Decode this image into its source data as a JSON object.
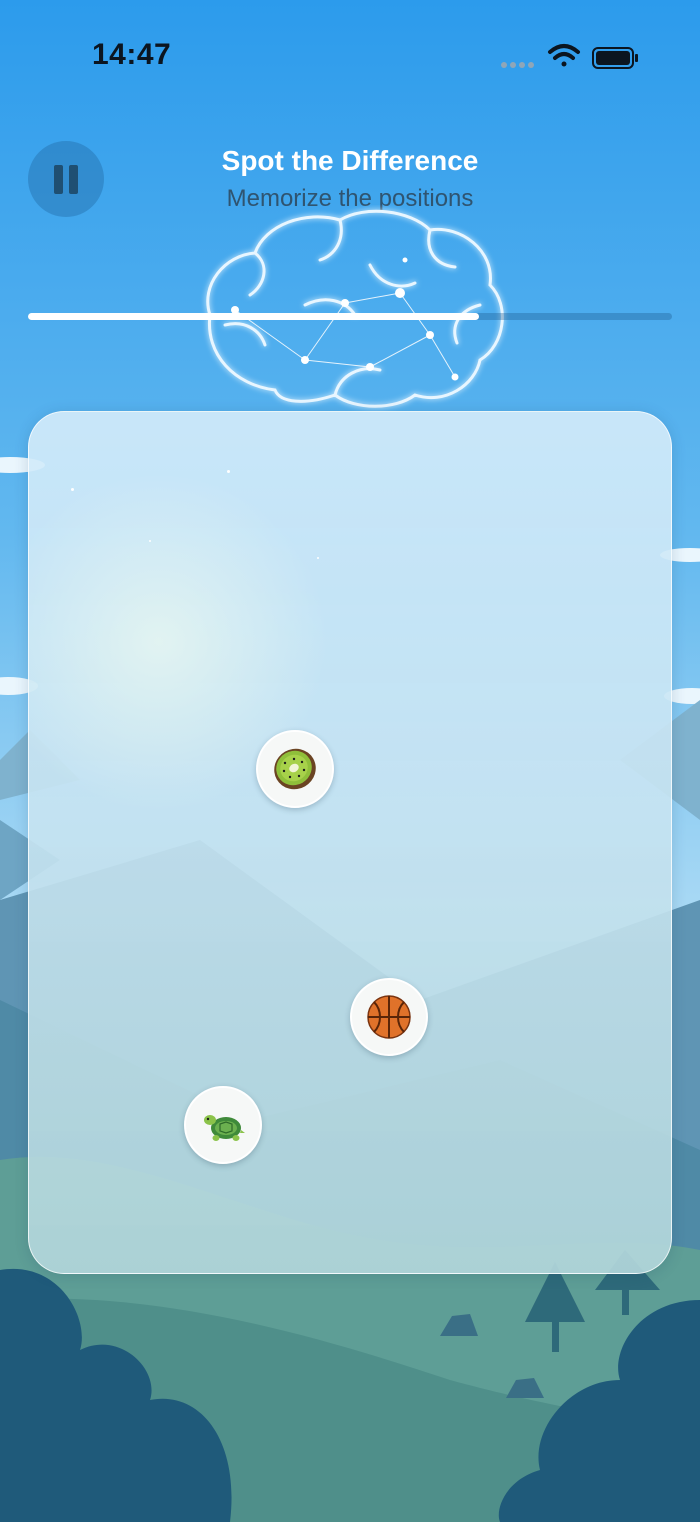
{
  "status_bar": {
    "time": "14:47",
    "icons": [
      "signal-dots-icon",
      "wifi-icon",
      "battery-icon"
    ]
  },
  "header": {
    "title": "Spot the Difference",
    "subtitle": "Memorize the positions",
    "pause_icon": "pause-icon"
  },
  "memorize_timer": {
    "progress": 0.7
  },
  "board": {
    "tokens": [
      {
        "name": "kiwi",
        "icon": "kiwi-icon"
      },
      {
        "name": "basketball",
        "icon": "basketball-icon"
      },
      {
        "name": "turtle",
        "icon": "turtle-icon"
      }
    ]
  },
  "colors": {
    "sky_top": "#2c9bec",
    "sky_bottom": "#a9d9f4",
    "mountain": "#5f95b4",
    "forest_dark": "#1f5a7a",
    "accent_white": "#ffffff"
  }
}
